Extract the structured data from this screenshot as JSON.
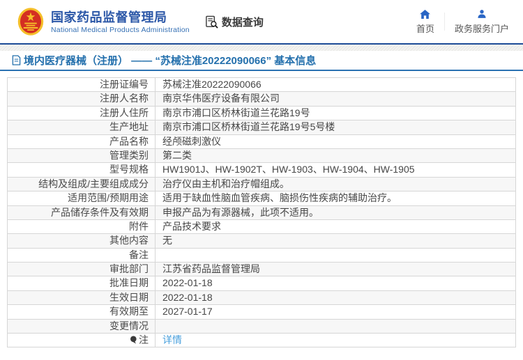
{
  "header": {
    "site_title": "国家药品监督管理局",
    "site_subtitle": "National Medical Products Administration",
    "logo_icon": "national-emblem-icon",
    "data_query": {
      "label": "数据查询",
      "icon": "document-search-icon"
    },
    "nav": [
      {
        "label": "首页",
        "icon": "home-icon"
      },
      {
        "label": "政务服务门户",
        "icon": "person-icon"
      }
    ]
  },
  "page_title": {
    "icon": "document-icon",
    "text": "境内医疗器械（注册） —— “苏械注准20222090066” 基本信息"
  },
  "colors": {
    "brand_blue": "#2b57a7",
    "accent_blue": "#2470ad",
    "nav_icon_blue": "#2a66c5",
    "link_blue": "#49a0dd",
    "header_rule_blue": "#1e4c97",
    "emblem_red": "#d42f22",
    "emblem_gold": "#f5bf2a",
    "row_alt_gray": "#f7f7f7"
  },
  "table": {
    "rows": [
      {
        "label": "注册证编号",
        "value": "苏械注准20222090066"
      },
      {
        "label": "注册人名称",
        "value": "南京华伟医疗设备有限公司"
      },
      {
        "label": "注册人住所",
        "value": "南京市浦口区桥林街道兰花路19号"
      },
      {
        "label": "生产地址",
        "value": "南京市浦口区桥林街道兰花路19号5号楼"
      },
      {
        "label": "产品名称",
        "value": "经颅磁刺激仪"
      },
      {
        "label": "管理类别",
        "value": "第二类"
      },
      {
        "label": "型号规格",
        "value": "HW1901J、HW-1902T、HW-1903、HW-1904、HW-1905"
      },
      {
        "label": "结构及组成/主要组成成分",
        "value": "治疗仪由主机和治疗帽组成。"
      },
      {
        "label": "适用范围/预期用途",
        "value": "适用于缺血性脑血管疾病、脑损伤性疾病的辅助治疗。"
      },
      {
        "label": "产品储存条件及有效期",
        "value": "申报产品为有源器械，此项不适用。"
      },
      {
        "label": "附件",
        "value": "产品技术要求"
      },
      {
        "label": "其他内容",
        "value": "无"
      },
      {
        "label": "备注",
        "value": ""
      },
      {
        "label": "审批部门",
        "value": "江苏省药品监督管理局"
      },
      {
        "label": "批准日期",
        "value": "2022-01-18"
      },
      {
        "label": "生效日期",
        "value": "2022-01-18"
      },
      {
        "label": "有效期至",
        "value": "2027-01-17"
      },
      {
        "label": "变更情况",
        "value": ""
      },
      {
        "label": "注",
        "value": "详情",
        "label_icon": "note-icon",
        "value_type": "link"
      }
    ]
  }
}
